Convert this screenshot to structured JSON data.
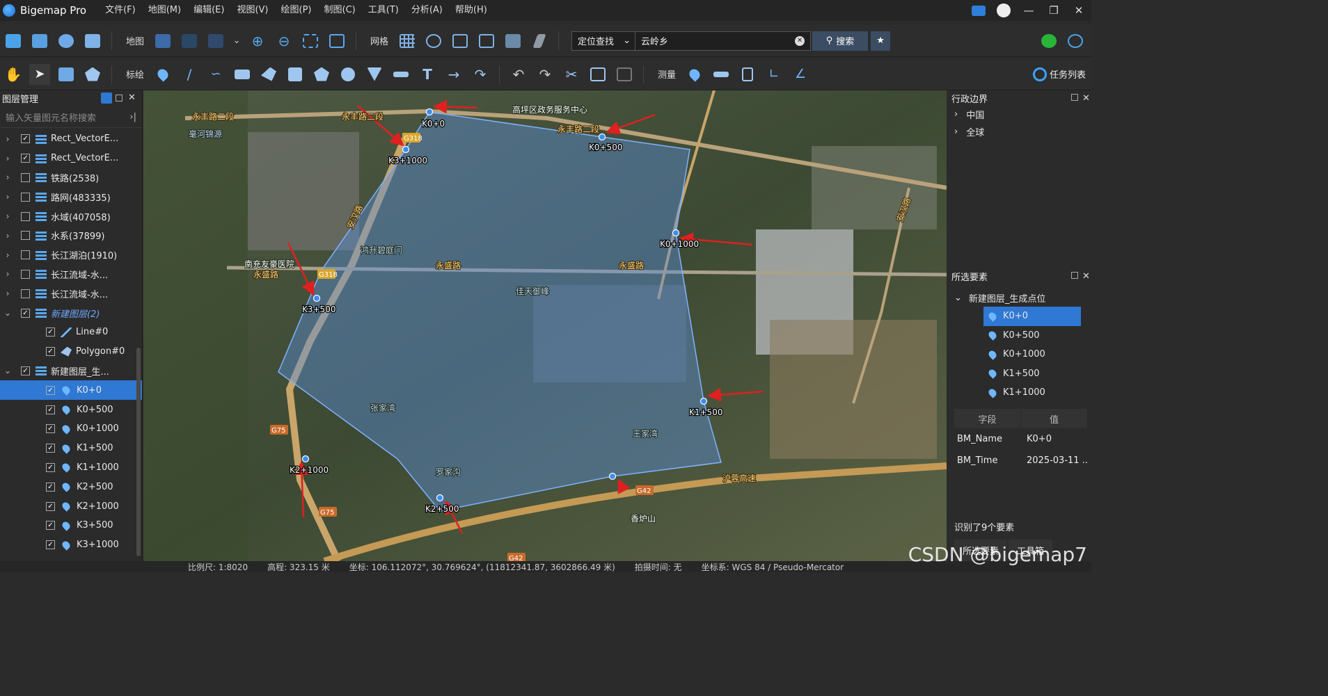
{
  "app": {
    "title": "Bigemap Pro"
  },
  "menu": [
    "文件(F)",
    "地图(M)",
    "编辑(E)",
    "视图(V)",
    "绘图(P)",
    "制图(C)",
    "工具(T)",
    "分析(A)",
    "帮助(H)"
  ],
  "toolbar1": {
    "map_label": "地图",
    "grid_label": "网格",
    "locate_select": "定位查找",
    "search_value": "云岭乡",
    "search_button": "搜索"
  },
  "toolbar2": {
    "draw_label": "标绘",
    "measure_label": "测量",
    "task_list": "任务列表"
  },
  "layer_panel": {
    "title": "图层管理",
    "search_placeholder": "输入矢量图元名称搜索",
    "rows": [
      {
        "label": "Rect_VectorE...",
        "checked": true,
        "expandable": true,
        "indent": 0
      },
      {
        "label": "Rect_VectorE...",
        "checked": true,
        "expandable": true,
        "indent": 0
      },
      {
        "label": "铁路(2538)",
        "checked": false,
        "expandable": true,
        "indent": 0
      },
      {
        "label": "路网(483335)",
        "checked": false,
        "expandable": true,
        "indent": 0
      },
      {
        "label": "水域(407058)",
        "checked": false,
        "expandable": true,
        "indent": 0
      },
      {
        "label": "水系(37899)",
        "checked": false,
        "expandable": true,
        "indent": 0
      },
      {
        "label": "长江湖泊(1910)",
        "checked": false,
        "expandable": true,
        "indent": 0
      },
      {
        "label": "长江流域-水...",
        "checked": false,
        "expandable": true,
        "indent": 0
      },
      {
        "label": "长江流域-水...",
        "checked": false,
        "expandable": true,
        "indent": 0
      },
      {
        "label": "新建图层(2)",
        "checked": true,
        "expanded": true,
        "indent": 0,
        "italic": true
      },
      {
        "label": "Line#0",
        "checked": true,
        "indent": 1,
        "icon": "line"
      },
      {
        "label": "Polygon#0",
        "checked": true,
        "indent": 1,
        "icon": "polygon"
      },
      {
        "label": "新建图层_生...",
        "checked": true,
        "expanded": true,
        "indent": 0
      },
      {
        "label": "K0+0",
        "checked": true,
        "indent": 1,
        "icon": "pin",
        "selected": true
      },
      {
        "label": "K0+500",
        "checked": true,
        "indent": 1,
        "icon": "pin"
      },
      {
        "label": "K0+1000",
        "checked": true,
        "indent": 1,
        "icon": "pin"
      },
      {
        "label": "K1+500",
        "checked": true,
        "indent": 1,
        "icon": "pin"
      },
      {
        "label": "K1+1000",
        "checked": true,
        "indent": 1,
        "icon": "pin"
      },
      {
        "label": "K2+500",
        "checked": true,
        "indent": 1,
        "icon": "pin"
      },
      {
        "label": "K2+1000",
        "checked": true,
        "indent": 1,
        "icon": "pin"
      },
      {
        "label": "K3+500",
        "checked": true,
        "indent": 1,
        "icon": "pin"
      },
      {
        "label": "K3+1000",
        "checked": true,
        "indent": 1,
        "icon": "pin"
      }
    ]
  },
  "map": {
    "road_labels": [
      "永丰路二段",
      "永丰路二段",
      "永丰路二段",
      "安汉路",
      "永盛路",
      "永盛路",
      "永盛路",
      "沪蓉高速",
      "安汉路"
    ],
    "place_labels": [
      "高坪区政务服务中心",
      "南充友豪医院",
      "鸿升碧庭门",
      "佳天御峰",
      "张家湾",
      "王家湾",
      "罗家沟",
      "香炉山",
      "毫河锦源"
    ],
    "shields": [
      "G318",
      "G318",
      "G75",
      "G75",
      "G42",
      "G42"
    ],
    "points": [
      "K0+0",
      "K0+500",
      "K0+1000",
      "K1+500",
      "K1+1000",
      "K2+500",
      "K2+1000",
      "K3+500",
      "K3+1000"
    ]
  },
  "right_panel": {
    "admin_title": "行政边界",
    "admin_items": [
      "中国",
      "全球"
    ],
    "selected_title": "所选要素",
    "group_label": "新建图层_生成点位",
    "selected_items": [
      "K0+0",
      "K0+500",
      "K0+1000",
      "K1+500",
      "K1+1000"
    ],
    "attr_header": [
      "字段",
      "值"
    ],
    "attrs": [
      {
        "field": "BM_Name",
        "value": "K0+0"
      },
      {
        "field": "BM_Time",
        "value": "2025-03-11 ..."
      }
    ],
    "recognized": "识别了9个要素",
    "tabs": [
      "所选要素",
      "工具箱"
    ]
  },
  "statusbar": {
    "scale": "比例尺: 1:8020",
    "elevation": "高程: 323.15 米",
    "coords": "坐标: 106.112072°, 30.769624°, (11812341.87, 3602866.49 米)",
    "capture_time": "拍摄时间: 无",
    "crs": "坐标系: WGS 84 / Pseudo-Mercator"
  },
  "watermark": "CSDN @bigemap7",
  "colors": {
    "accent": "#2f78d3",
    "polygon_fill": "#4a7fc4",
    "arrow": "#e02020"
  }
}
